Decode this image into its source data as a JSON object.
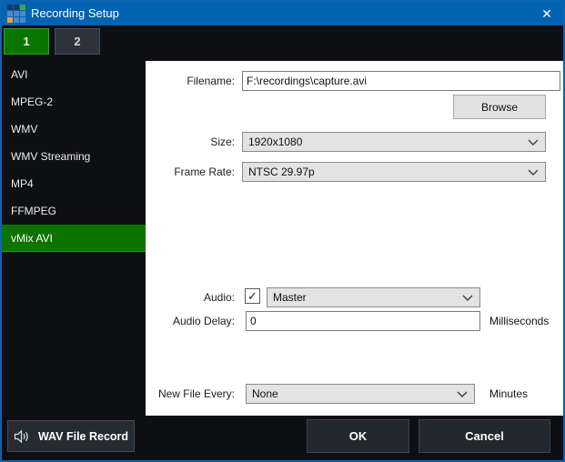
{
  "window": {
    "title": "Recording Setup",
    "close_glyph": "✕"
  },
  "tabs": [
    {
      "label": "1",
      "active": true
    },
    {
      "label": "2",
      "active": false
    }
  ],
  "sidebar": {
    "items": [
      {
        "label": "AVI"
      },
      {
        "label": "MPEG-2"
      },
      {
        "label": "WMV"
      },
      {
        "label": "WMV Streaming"
      },
      {
        "label": "MP4"
      },
      {
        "label": "FFMPEG"
      },
      {
        "label": "vMix AVI",
        "selected": true
      }
    ]
  },
  "form": {
    "filename": {
      "label": "Filename:",
      "value": "F:\\recordings\\capture.avi"
    },
    "browse_label": "Browse",
    "size": {
      "label": "Size:",
      "value": "1920x1080"
    },
    "frame_rate": {
      "label": "Frame Rate:",
      "value": "NTSC 29.97p"
    },
    "audio": {
      "label": "Audio:",
      "checked": true,
      "check_glyph": "✓",
      "value": "Master"
    },
    "audio_delay": {
      "label": "Audio Delay:",
      "value": "0",
      "unit": "Milliseconds"
    },
    "new_file_every": {
      "label": "New File Every:",
      "value": "None",
      "unit": "Minutes"
    }
  },
  "footer": {
    "wav_button": "WAV File Record",
    "ok": "OK",
    "cancel": "Cancel"
  },
  "colors": {
    "titlebar": "#0063b1",
    "selected_green": "#0d7300",
    "tab_green": "#0a7500",
    "window_bg": "#0d0f12",
    "panel_bg": "#ffffff"
  }
}
